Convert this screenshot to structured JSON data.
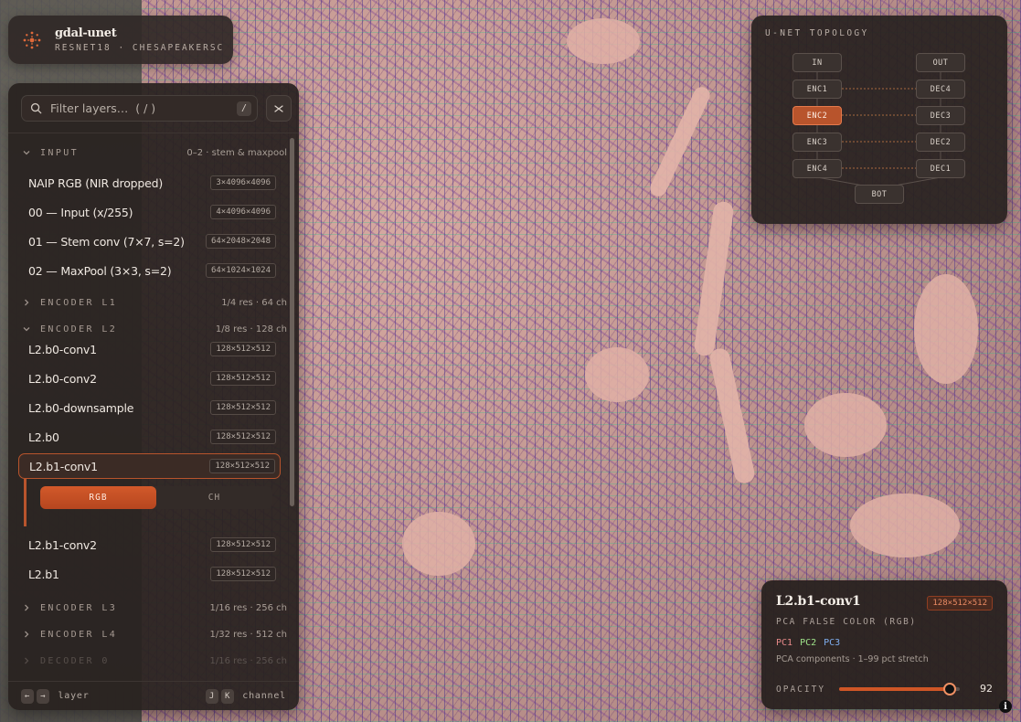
{
  "brand": {
    "title": "gdal-unet",
    "subtitle": "RESNET18 · CHESAPEAKERSC"
  },
  "search": {
    "placeholder": "Filter layers…  ( / )",
    "shortcut": "/"
  },
  "groups": {
    "input": {
      "name": "INPUT",
      "meta": "0–2 · stem & maxpool",
      "expanded": true
    },
    "encoder_l1": {
      "name": "ENCODER L1",
      "meta": "1/4 res · 64 ch",
      "expanded": false
    },
    "encoder_l2": {
      "name": "ENCODER L2",
      "meta": "1/8 res · 128 ch",
      "expanded": true
    },
    "encoder_l3": {
      "name": "ENCODER L3",
      "meta": "1/16 res · 256 ch",
      "expanded": false
    },
    "encoder_l4": {
      "name": "ENCODER L4",
      "meta": "1/32 res · 512 ch",
      "expanded": false
    },
    "decoder_0": {
      "name": "DECODER 0",
      "meta": "1/16 res · 256 ch",
      "expanded": false
    }
  },
  "input_layers": [
    {
      "name": "NAIP RGB (NIR dropped)",
      "shape": "3×4096×4096"
    },
    {
      "name": "00 — Input (x/255)",
      "shape": "4×4096×4096"
    },
    {
      "name": "01 — Stem conv (7×7, s=2)",
      "shape": "64×2048×2048"
    },
    {
      "name": "02 — MaxPool (3×3, s=2)",
      "shape": "64×1024×1024"
    }
  ],
  "l2_layers": [
    {
      "name": "L2.b0-conv1",
      "shape": "128×512×512"
    },
    {
      "name": "L2.b0-conv2",
      "shape": "128×512×512"
    },
    {
      "name": "L2.b0-downsample",
      "shape": "128×512×512"
    },
    {
      "name": "L2.b0",
      "shape": "128×512×512"
    },
    {
      "name": "L2.b1-conv1",
      "shape": "128×512×512",
      "selected": true
    },
    {
      "name": "L2.b1-conv2",
      "shape": "128×512×512"
    },
    {
      "name": "L2.b1",
      "shape": "128×512×512"
    }
  ],
  "view_mode": {
    "options": [
      "RGB",
      "CH"
    ],
    "selected": "RGB"
  },
  "footer": {
    "prev_key": "←",
    "next_key": "→",
    "layer_label": "layer",
    "ch_key_1": "J",
    "ch_key_2": "K",
    "channel_label": "channel"
  },
  "topology": {
    "title": "U-NET TOPOLOGY",
    "left_nodes": [
      "IN",
      "ENC1",
      "ENC2",
      "ENC3",
      "ENC4"
    ],
    "right_nodes": [
      "OUT",
      "DEC4",
      "DEC3",
      "DEC2",
      "DEC1"
    ],
    "bottom_node": "BOT",
    "active_node": "ENC2"
  },
  "info": {
    "title": "L2.b1-conv1",
    "shape": "128×512×512",
    "subtitle": "PCA FALSE COLOR (RGB)",
    "pcs": [
      "PC1",
      "PC2",
      "PC3"
    ],
    "pc_colors": [
      "#e98a8a",
      "#9fe38a",
      "#7faef0"
    ],
    "note": "PCA components · 1–99 pct stretch",
    "opacity_label": "OPACITY",
    "opacity_value": "92",
    "opacity_fraction": 0.92
  },
  "colors": {
    "accent": "#cf5626"
  }
}
